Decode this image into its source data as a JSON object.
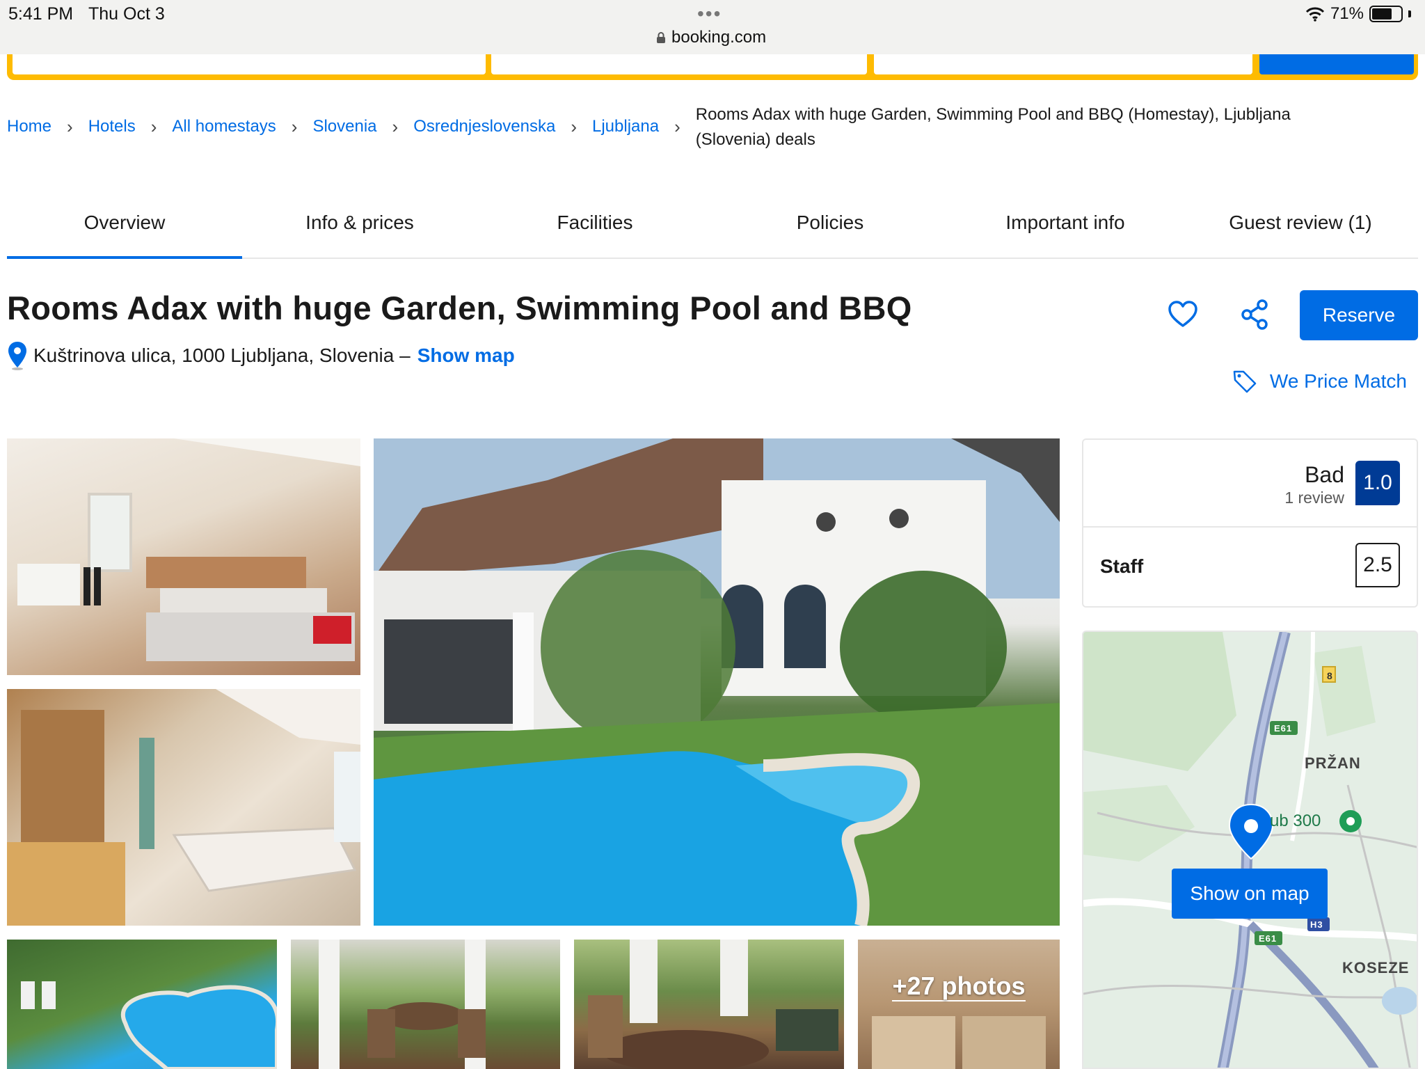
{
  "status_bar": {
    "time": "5:41 PM",
    "date": "Thu Oct 3",
    "url": "booking.com",
    "battery": "71%",
    "battery_level": 0.71
  },
  "breadcrumb": {
    "items": [
      "Home",
      "Hotels",
      "All homestays",
      "Slovenia",
      "Osrednjeslovenska",
      "Ljubljana"
    ],
    "separator": "›",
    "current": "Rooms Adax with huge Garden, Swimming Pool and BBQ (Homestay), Ljubljana (Slovenia) deals"
  },
  "tabs": [
    {
      "label": "Overview",
      "active": true
    },
    {
      "label": "Info & prices",
      "active": false
    },
    {
      "label": "Facilities",
      "active": false
    },
    {
      "label": "Policies",
      "active": false
    },
    {
      "label": "Important info",
      "active": false
    },
    {
      "label": "Guest review (1)",
      "active": false
    }
  ],
  "property": {
    "title": "Rooms Adax with huge Garden, Swimming Pool and BBQ",
    "address": "Kuštrinova ulica, 1000 Ljubljana, Slovenia –",
    "show_map": "Show map"
  },
  "actions": {
    "reserve": "Reserve",
    "price_match": "We Price Match",
    "favorite_icon": "heart-icon",
    "share_icon": "share-icon"
  },
  "gallery": {
    "more_photos": "+27 photos"
  },
  "review": {
    "word": "Bad",
    "count": "1 review",
    "score": "1.0",
    "category": "Staff",
    "category_score": "2.5"
  },
  "map": {
    "labels": {
      "road_e61_top": "E61",
      "road_e61_bottom": "E61",
      "road_h3": "H3",
      "road_8": "8",
      "district_1": "PRŽAN",
      "district_2": "KOSEZE",
      "place": "ub 300"
    },
    "show_on_map": "Show on map"
  },
  "colors": {
    "brand_blue": "#006ce4",
    "dark_blue": "#003b95",
    "search_yellow": "#febb02"
  }
}
